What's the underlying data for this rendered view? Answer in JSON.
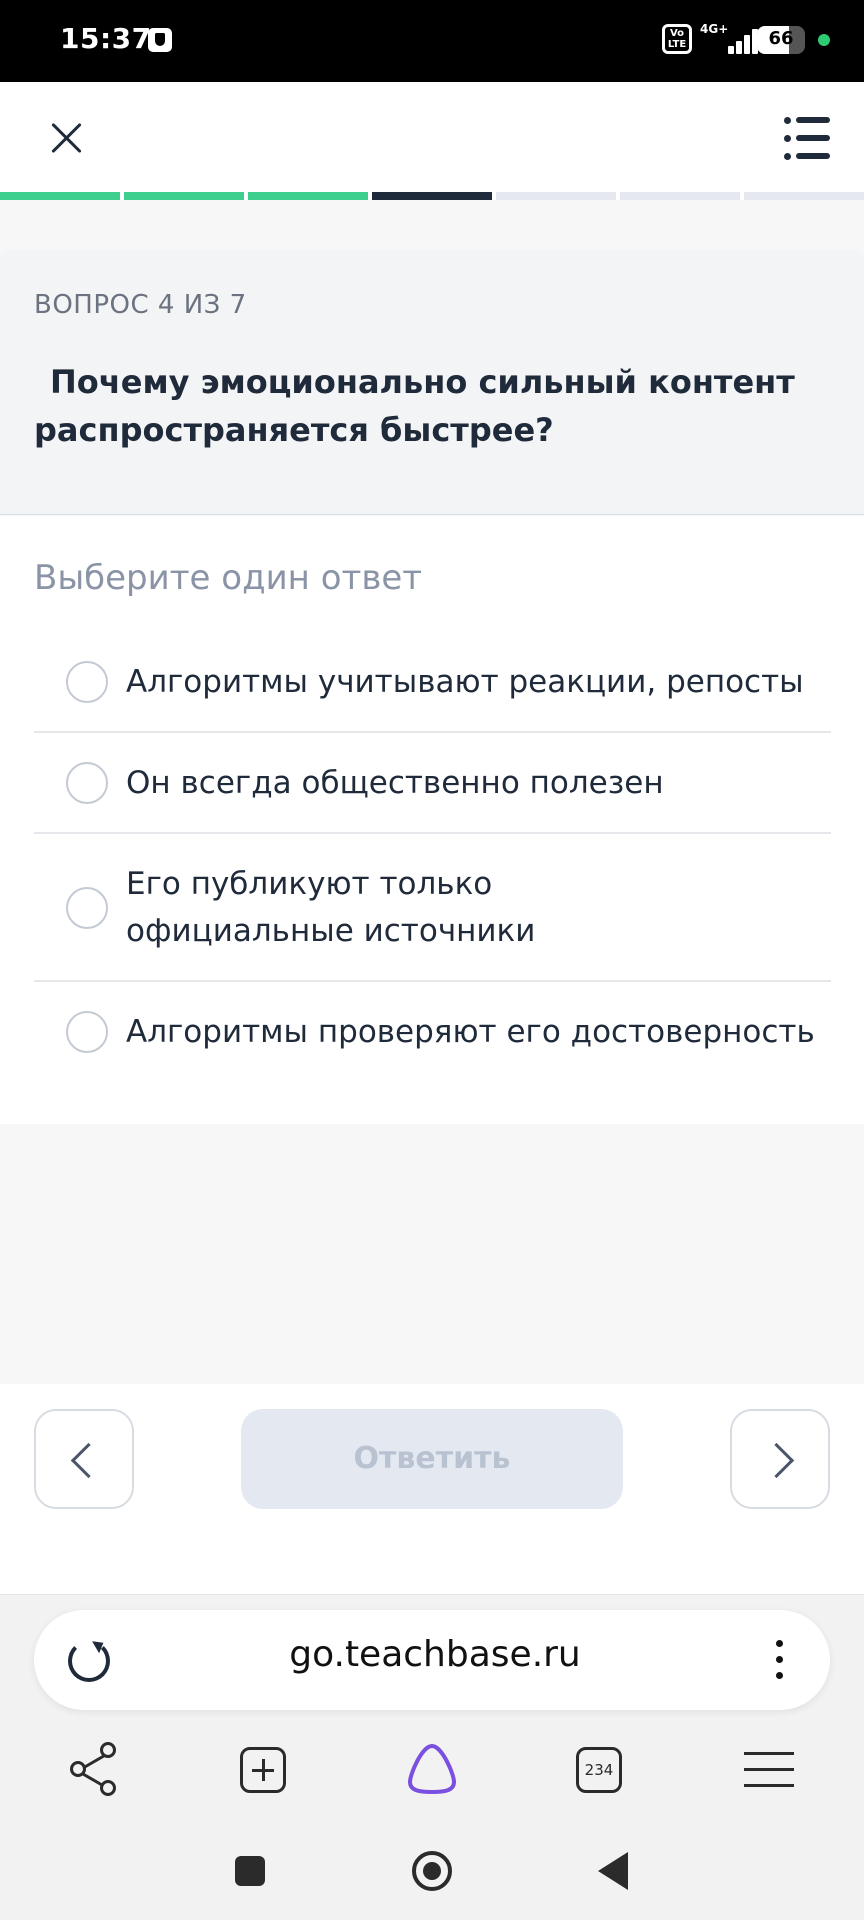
{
  "status_bar": {
    "time": "15:37",
    "volte_label": "Vo\nLTE",
    "network": "4G+",
    "battery": "66",
    "battery_level": 0.66,
    "dot_color": "#2ecc71"
  },
  "header": {
    "close_icon": "close-icon",
    "menu_icon": "list-icon"
  },
  "progress": {
    "total": 7,
    "current": 4,
    "completed_color": "#3ecf8e",
    "current_color": "#1f2a3a",
    "pending_color": "#e5e8ee"
  },
  "question": {
    "counter": "ВОПРОС 4 ИЗ 7",
    "title": "Почему эмоционально сильный контент распространяется быстрее?"
  },
  "answers": {
    "instruction": "Выберите один ответ",
    "options": [
      {
        "label": "Алгоритмы учитывают реакции, репосты",
        "selected": false
      },
      {
        "label": "Он всегда общественно полезен",
        "selected": false
      },
      {
        "label": "Его публикуют только официальные источники",
        "selected": false
      },
      {
        "label": "Алгоритмы проверяют его достоверность",
        "selected": false
      }
    ]
  },
  "actions": {
    "answer_label": "Ответить",
    "prev_icon": "chevron-left-icon",
    "next_icon": "chevron-right-icon"
  },
  "browser": {
    "url": "go.teachbase.ru",
    "tabs_count": "234",
    "toolbar_icons": [
      "share-icon",
      "new-tab-icon",
      "alice-icon",
      "tabs-icon",
      "menu-icon"
    ]
  },
  "system_nav": [
    "recents-icon",
    "home-icon",
    "back-icon"
  ]
}
